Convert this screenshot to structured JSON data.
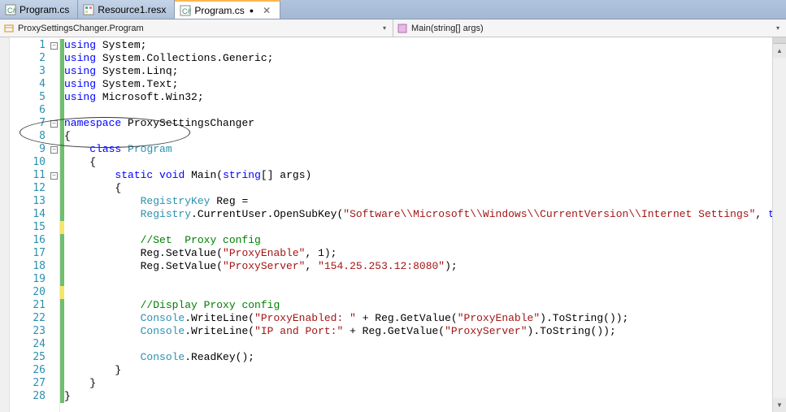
{
  "tabs": [
    {
      "label": "Program.cs",
      "active": false,
      "dirty": false
    },
    {
      "label": "Resource1.resx",
      "active": false,
      "dirty": false
    },
    {
      "label": "Program.cs",
      "active": true,
      "dirty": true
    }
  ],
  "nav": {
    "class_scope": "ProxySettingsChanger.Program",
    "method_scope": "Main(string[] args)"
  },
  "code": {
    "lines_total": 28,
    "tokens": [
      [
        [
          "kw",
          "using"
        ],
        [
          "",
          " "
        ],
        [
          "",
          "System"
        ],
        [
          "",
          ";"
        ]
      ],
      [
        [
          "kw",
          "using"
        ],
        [
          "",
          " "
        ],
        [
          "",
          "System.Collections.Generic"
        ],
        [
          "",
          ";"
        ]
      ],
      [
        [
          "kw",
          "using"
        ],
        [
          "",
          " "
        ],
        [
          "",
          "System.Linq"
        ],
        [
          "",
          ";"
        ]
      ],
      [
        [
          "kw",
          "using"
        ],
        [
          "",
          " "
        ],
        [
          "",
          "System.Text"
        ],
        [
          "",
          ";"
        ]
      ],
      [
        [
          "kw",
          "using"
        ],
        [
          "",
          " "
        ],
        [
          "",
          "Microsoft.Win32"
        ],
        [
          "",
          ";"
        ]
      ],
      [],
      [
        [
          "kw",
          "namespace"
        ],
        [
          "",
          " ProxySettingsChanger"
        ]
      ],
      [
        [
          "",
          "{"
        ]
      ],
      [
        [
          "",
          "    "
        ],
        [
          "kw",
          "class"
        ],
        [
          "",
          " "
        ],
        [
          "type",
          "Program"
        ]
      ],
      [
        [
          "",
          "    {"
        ]
      ],
      [
        [
          "",
          "        "
        ],
        [
          "kw",
          "static"
        ],
        [
          "",
          " "
        ],
        [
          "kw",
          "void"
        ],
        [
          "",
          " Main("
        ],
        [
          "kw",
          "string"
        ],
        [
          "",
          "[] args)"
        ]
      ],
      [
        [
          "",
          "        {"
        ]
      ],
      [
        [
          "",
          "            "
        ],
        [
          "type",
          "RegistryKey"
        ],
        [
          "",
          " Reg = "
        ]
      ],
      [
        [
          "",
          "            "
        ],
        [
          "type",
          "Registry"
        ],
        [
          "",
          ".CurrentUser.OpenSubKey("
        ],
        [
          "str",
          "\"Software\\\\Microsoft\\\\Windows\\\\CurrentVersion\\\\Internet Settings\""
        ],
        [
          "",
          ", "
        ],
        [
          "kw",
          "true"
        ],
        [
          "",
          ");"
        ]
      ],
      [],
      [
        [
          "",
          "            "
        ],
        [
          "comment",
          "//Set  Proxy config"
        ]
      ],
      [
        [
          "",
          "            Reg.SetValue("
        ],
        [
          "str",
          "\"ProxyEnable\""
        ],
        [
          "",
          ", 1);"
        ]
      ],
      [
        [
          "",
          "            Reg.SetValue("
        ],
        [
          "str",
          "\"ProxyServer\""
        ],
        [
          "",
          ", "
        ],
        [
          "str",
          "\"154.25.253.12:8080\""
        ],
        [
          "",
          ");"
        ]
      ],
      [],
      [],
      [
        [
          "",
          "            "
        ],
        [
          "comment",
          "//Display Proxy config"
        ]
      ],
      [
        [
          "",
          "            "
        ],
        [
          "type",
          "Console"
        ],
        [
          "",
          ".WriteLine("
        ],
        [
          "str",
          "\"ProxyEnabled: \""
        ],
        [
          "",
          " + Reg.GetValue("
        ],
        [
          "str",
          "\"ProxyEnable\""
        ],
        [
          "",
          ").ToString());"
        ]
      ],
      [
        [
          "",
          "            "
        ],
        [
          "type",
          "Console"
        ],
        [
          "",
          ".WriteLine("
        ],
        [
          "str",
          "\"IP and Port:\""
        ],
        [
          "",
          " + Reg.GetValue("
        ],
        [
          "str",
          "\"ProxyServer\""
        ],
        [
          "",
          ").ToString());"
        ]
      ],
      [],
      [
        [
          "",
          "            "
        ],
        [
          "type",
          "Console"
        ],
        [
          "",
          ".ReadKey();"
        ]
      ],
      [
        [
          "",
          "        }"
        ]
      ],
      [
        [
          "",
          "    }"
        ]
      ],
      [
        [
          "",
          "}"
        ]
      ]
    ],
    "change_bars": [
      "saved",
      "saved",
      "saved",
      "saved",
      "saved",
      "saved",
      "saved",
      "saved",
      "saved",
      "saved",
      "saved",
      "saved",
      "saved",
      "saved",
      "modified",
      "saved",
      "saved",
      "saved",
      "saved",
      "modified",
      "saved",
      "saved",
      "saved",
      "saved",
      "saved",
      "saved",
      "saved",
      "saved"
    ],
    "fold_marks": {
      "1": "minus",
      "7": "minus",
      "9": "minus",
      "11": "minus"
    }
  }
}
